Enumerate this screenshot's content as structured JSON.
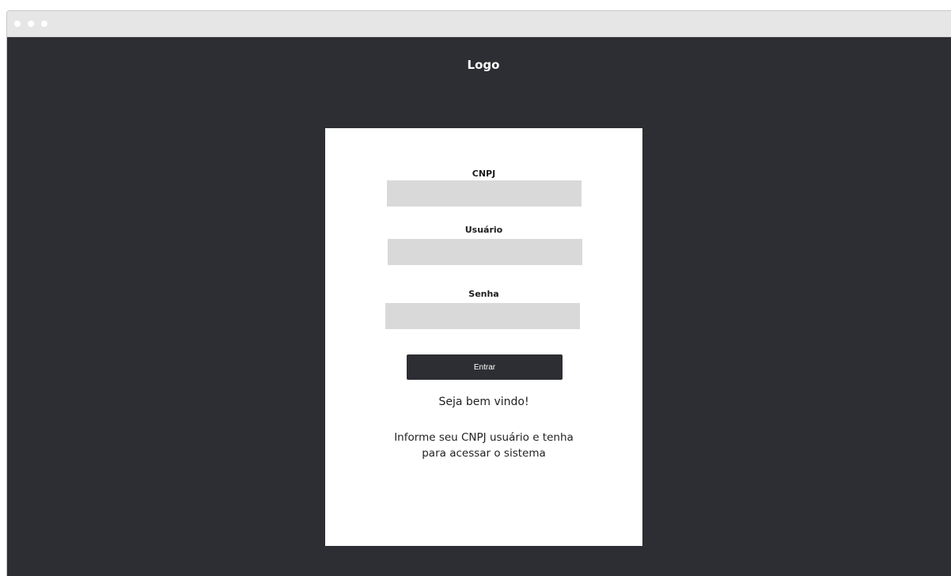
{
  "header": {
    "logo_text": "Logo"
  },
  "form": {
    "cnpj_label": "CNPJ",
    "cnpj_value": "",
    "usuario_label": "Usuário",
    "usuario_value": "",
    "senha_label": "Senha",
    "senha_value": "",
    "submit_label": "Entrar"
  },
  "messages": {
    "welcome": "Seja bem vindo!",
    "instructions_line1": "Informe seu CNPJ usuário e tenha",
    "instructions_line2": "para acessar o sistema"
  },
  "colors": {
    "page_background": "#2d2e33",
    "card_background": "#ffffff",
    "field_background": "#d9d9d9",
    "button_background": "#2d2e33"
  }
}
